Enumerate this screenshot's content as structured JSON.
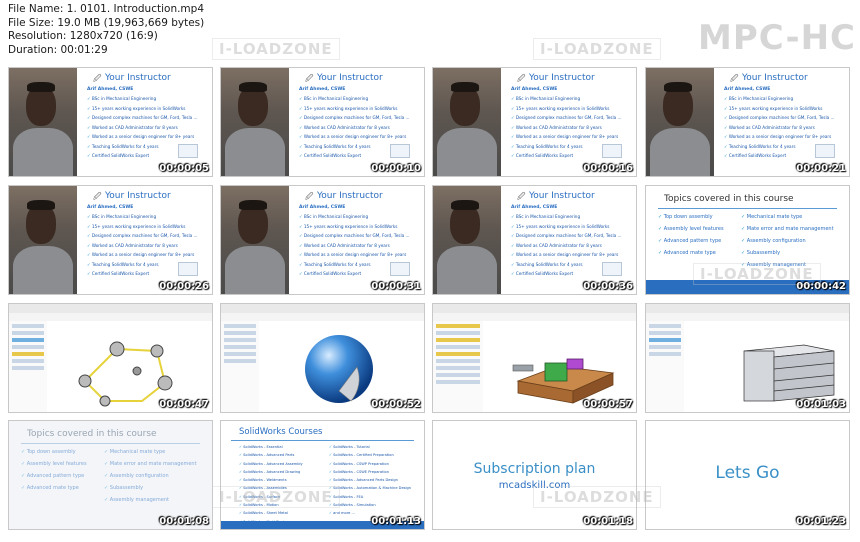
{
  "file_info": {
    "name": "File Name: 1. 0101. Introduction.mp4",
    "size": "File Size: 19.0 MB (19,963,669 bytes)",
    "resolution": "Resolution: 1280x720 (16:9)",
    "duration": "Duration: 00:01:29"
  },
  "player_logo": "MPC-HC",
  "watermark": "I-LOADZONE",
  "instructor": {
    "title": "Your Instructor",
    "name": "Arif Ahmed, CSWE",
    "bullets": [
      "BSc in Mechanical Engineering",
      "15+ years working experience in SolidWorks",
      "Designed complex machines for GM, Ford, Tesla ...",
      "Worked as CAD Administrator for 8 years",
      "Worked as a senior design engineer for 8+ years",
      "Teaching SolidWorks for 4 years",
      "Certified SolidWorks Expert"
    ]
  },
  "topics": {
    "title": "Topics covered in this course",
    "left": [
      "Top down assembly",
      "Assembly level features",
      "Advanced pattern type",
      "Advanced mate type"
    ],
    "right": [
      "Mechanical mate type",
      "Mate error and mate management",
      "Assembly configuration",
      "Subassembly",
      "Assembly management"
    ]
  },
  "courses": {
    "title": "SolidWorks Courses",
    "left": [
      "SolidWorks - Essential",
      "SolidWorks - Advanced Parts",
      "SolidWorks - Advanced Assembly",
      "SolidWorks - Advanced Drawing",
      "SolidWorks - Weldments",
      "SolidWorks - Assemblies",
      "SolidWorks - Surface",
      "SolidWorks - Motion",
      "SolidWorks - Sheet Metal",
      "SolidWorks - Mold Design"
    ],
    "right": [
      "SolidWorks - Tutorial",
      "SolidWorks - Certified Preparation",
      "SolidWorks - CSWP Preparation",
      "SolidWorks - CSWE Preparation",
      "SolidWorks - Advanced Parts Design",
      "SolidWorks - Automation & Machine Design",
      "SolidWorks - FEA",
      "SolidWorks - Simulation",
      "and more ..."
    ]
  },
  "subscription": {
    "title": "Subscription plan",
    "site": "mcadskill.com"
  },
  "letsgo": "Lets Go",
  "timestamps": [
    "00:00:05",
    "00:00:10",
    "00:00:16",
    "00:00:21",
    "00:00:26",
    "00:00:31",
    "00:00:36",
    "00:00:42",
    "00:00:47",
    "00:00:52",
    "00:00:57",
    "00:01:03",
    "00:01:08",
    "00:01:13",
    "00:01:18",
    "00:01:23"
  ],
  "colors": {
    "accent_blue": "#2a6ec0",
    "light_blue": "#3a8fc7",
    "metal_blue": "#3f8fdc"
  }
}
